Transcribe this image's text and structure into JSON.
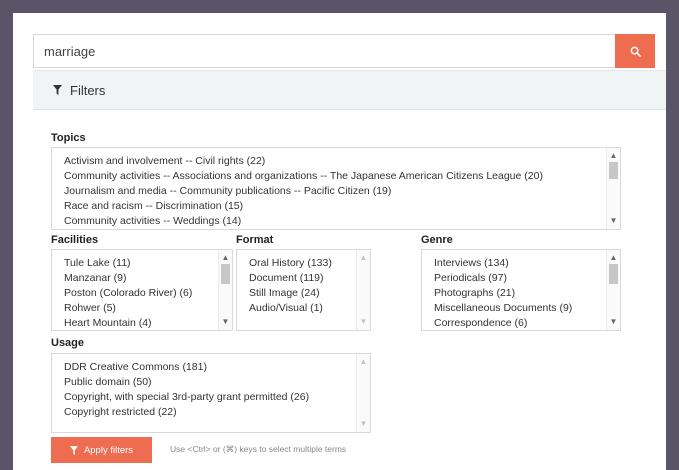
{
  "search": {
    "value": "marriage"
  },
  "filters": {
    "title": "Filters"
  },
  "topics": {
    "label": "Topics",
    "items": [
      "Activism and involvement -- Civil rights (22)",
      "Community activities -- Associations and organizations -- The Japanese American Citizens League (20)",
      "Journalism and media -- Community publications -- Pacific Citizen (19)",
      "Race and racism -- Discrimination (15)",
      "Community activities -- Weddings (14)"
    ]
  },
  "facilities": {
    "label": "Facilities",
    "items": [
      "Tule Lake (11)",
      "Manzanar (9)",
      "Poston (Colorado River) (6)",
      "Rohwer (5)",
      "Heart Mountain (4)"
    ]
  },
  "format": {
    "label": "Format",
    "items": [
      "Oral History (133)",
      "Document (119)",
      "Still Image (24)",
      "Audio/Visual (1)"
    ]
  },
  "genre": {
    "label": "Genre",
    "items": [
      "Interviews (134)",
      "Periodicals (97)",
      "Photographs (21)",
      "Miscellaneous Documents (9)",
      "Correspondence (6)"
    ]
  },
  "usage": {
    "label": "Usage",
    "items": [
      "DDR Creative Commons (181)",
      "Public domain (50)",
      "Copyright, with special 3rd-party grant permitted (26)",
      "Copyright restricted (22)"
    ]
  },
  "actions": {
    "apply_label": "Apply filters",
    "hint": "Use <Ctrl> or (⌘) keys to select multiple terms"
  },
  "colors": {
    "accent": "#ee6c4f",
    "header_bg": "#f1f4f4",
    "frame": "#5a5566"
  }
}
